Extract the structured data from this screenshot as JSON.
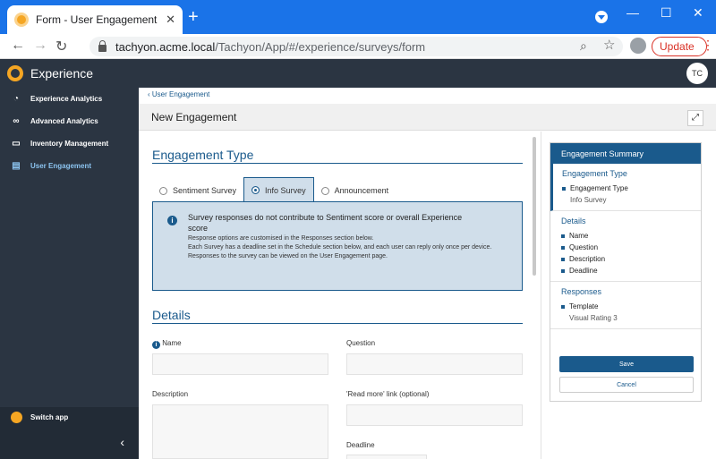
{
  "browser": {
    "tab_title": "Form - User Engagement - Expe",
    "url_host": "tachyon.acme.local",
    "url_path": "/Tachyon/App/#/experience/surveys/form",
    "update_label": "Update"
  },
  "app": {
    "name": "Experience",
    "user_initials": "TC"
  },
  "sidebar": {
    "items": [
      {
        "label": "Experience Analytics",
        "icon": "speedometer-icon"
      },
      {
        "label": "Advanced Analytics",
        "icon": "binoculars-icon"
      },
      {
        "label": "Inventory Management",
        "icon": "monitor-icon"
      },
      {
        "label": "User Engagement",
        "icon": "clipboard-icon",
        "active": true
      }
    ],
    "switch_app": "Switch app"
  },
  "page": {
    "breadcrumb": "User Engagement",
    "title": "New Engagement"
  },
  "engagement_type": {
    "heading": "Engagement Type",
    "options": [
      "Sentiment Survey",
      "Info Survey",
      "Announcement"
    ],
    "selected": "Info Survey",
    "info_heading": "Survey responses do not contribute to Sentiment score or overall Experience score",
    "info_lines": [
      "Response options are customised in the Responses section below.",
      "Each Survey has a deadline set in the Schedule section below, and each user can reply only once per device.",
      "Responses to the survey can be viewed on the User Engagement page."
    ]
  },
  "details": {
    "heading": "Details",
    "name_label": "Name",
    "question_label": "Question",
    "description_label": "Description",
    "read_more_label": "'Read more' link",
    "read_more_hint": "(optional)",
    "deadline_label": "Deadline"
  },
  "summary": {
    "title": "Engagement Summary",
    "sections": [
      {
        "title": "Engagement Type",
        "items": [
          {
            "label": "Engagement Type",
            "value": "Info Survey"
          }
        ]
      },
      {
        "title": "Details",
        "items": [
          {
            "label": "Name"
          },
          {
            "label": "Question"
          },
          {
            "label": "Description"
          },
          {
            "label": "Deadline"
          }
        ]
      },
      {
        "title": "Responses",
        "items": [
          {
            "label": "Template",
            "value": "Visual Rating 3"
          }
        ]
      }
    ],
    "save_label": "Save",
    "cancel_label": "Cancel"
  },
  "colors": {
    "accent": "#1a5a8c",
    "sidebar_bg": "#2b3542",
    "browser_blue": "#1a73e8",
    "info_bg": "#d0deea",
    "update_red": "#d93025"
  }
}
